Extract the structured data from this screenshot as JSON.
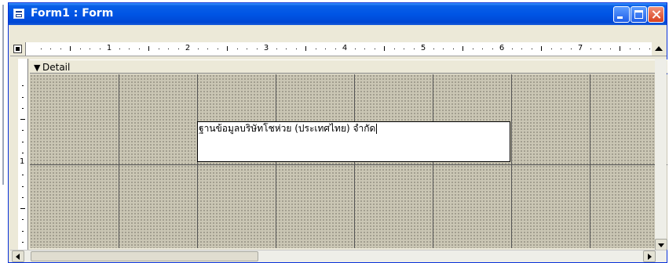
{
  "window": {
    "title": "Form1 : Form",
    "title_color": "#ffffff",
    "titlebar_color": "#0055e5",
    "system_icon": "form-icon",
    "caption_buttons": [
      "minimize-icon",
      "maximize-icon",
      "close-icon"
    ]
  },
  "ruler": {
    "horizontal_marks": [
      "1",
      "2",
      "3",
      "4",
      "5",
      "6",
      "7"
    ],
    "vertical_marks": [
      "1"
    ]
  },
  "section": {
    "label": "Detail",
    "icon": "section-arrow-icon"
  },
  "design_grid": {
    "grid_color": "#cac6b4",
    "dot_color": "#6d6a5f"
  },
  "label_control": {
    "text": "ฐานข้อมูลบริษัทโชห่วย (ประเทศไทย) จำกัด"
  }
}
